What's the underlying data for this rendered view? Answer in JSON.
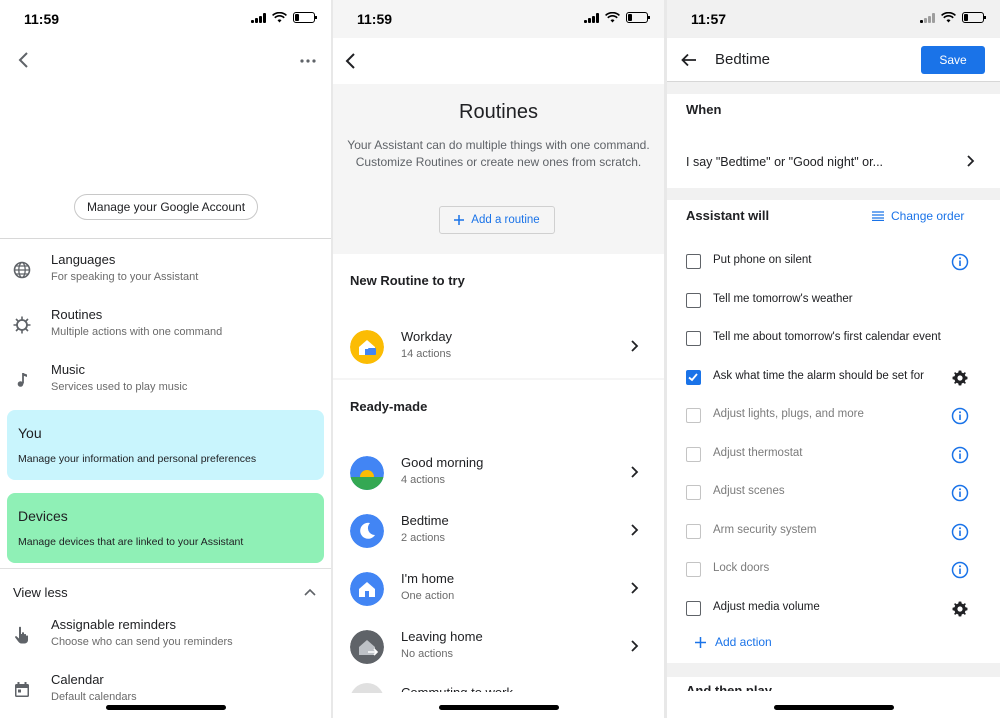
{
  "colors": {
    "accent": "#1a73e8",
    "you_card": "#c9f5fd",
    "devices_card": "#8ff0b6"
  },
  "panel1": {
    "time": "11:59",
    "manage_account": "Manage your Google Account",
    "items": [
      {
        "title": "Languages",
        "subtitle": "For speaking to your Assistant",
        "icon": "globe-icon"
      },
      {
        "title": "Routines",
        "subtitle": "Multiple actions with one command",
        "icon": "routines-icon"
      },
      {
        "title": "Music",
        "subtitle": "Services used to play music",
        "icon": "music-note-icon"
      }
    ],
    "cards": [
      {
        "title": "You",
        "subtitle": "Manage your information and personal preferences"
      },
      {
        "title": "Devices",
        "subtitle": "Manage devices that are linked to your Assistant"
      }
    ],
    "view_less": "View less",
    "more_items": [
      {
        "title": "Assignable reminders",
        "subtitle": "Choose who can send you reminders",
        "icon": "hand-pointer-icon"
      },
      {
        "title": "Calendar",
        "subtitle": "Default calendars",
        "icon": "calendar-icon"
      }
    ]
  },
  "panel2": {
    "time": "11:59",
    "title": "Routines",
    "description": "Your Assistant can do multiple things with one command. Customize Routines or create new ones from scratch.",
    "add_routine": "Add a routine",
    "new_section": "New Routine to try",
    "new_routines": [
      {
        "title": "Workday",
        "subtitle": "14 actions",
        "icon": "workday-icon"
      }
    ],
    "ready_section": "Ready-made",
    "ready_routines": [
      {
        "title": "Good morning",
        "subtitle": "4 actions",
        "icon": "sunrise-icon"
      },
      {
        "title": "Bedtime",
        "subtitle": "2 actions",
        "icon": "moon-icon"
      },
      {
        "title": "I'm home",
        "subtitle": "One action",
        "icon": "house-icon"
      },
      {
        "title": "Leaving home",
        "subtitle": "No actions",
        "icon": "leaving-home-icon"
      }
    ],
    "cut_item": "Commuting to work"
  },
  "panel3": {
    "time": "11:57",
    "title": "Bedtime",
    "save": "Save",
    "when_label": "When",
    "when_value": "I say \"Bedtime\" or \"Good night\" or...",
    "assistant_will": "Assistant will",
    "change_order": "Change order",
    "actions": [
      {
        "label": "Put phone on silent",
        "checked": false,
        "enabled": true,
        "icon": "info-icon"
      },
      {
        "label": "Tell me tomorrow's weather",
        "checked": false,
        "enabled": true,
        "icon": ""
      },
      {
        "label": "Tell me about tomorrow's first calendar event",
        "checked": false,
        "enabled": true,
        "icon": ""
      },
      {
        "label": "Ask what time the alarm should be set for",
        "checked": true,
        "enabled": true,
        "icon": "gear-icon"
      },
      {
        "label": "Adjust lights, plugs, and more",
        "checked": false,
        "enabled": false,
        "icon": "info-icon"
      },
      {
        "label": "Adjust thermostat",
        "checked": false,
        "enabled": false,
        "icon": "info-icon"
      },
      {
        "label": "Adjust scenes",
        "checked": false,
        "enabled": false,
        "icon": "info-icon"
      },
      {
        "label": "Arm security system",
        "checked": false,
        "enabled": false,
        "icon": "info-icon"
      },
      {
        "label": "Lock doors",
        "checked": false,
        "enabled": false,
        "icon": "info-icon"
      },
      {
        "label": "Adjust media volume",
        "checked": false,
        "enabled": true,
        "icon": "gear-icon"
      }
    ],
    "add_action": "Add action",
    "cut_section": "And then play"
  }
}
